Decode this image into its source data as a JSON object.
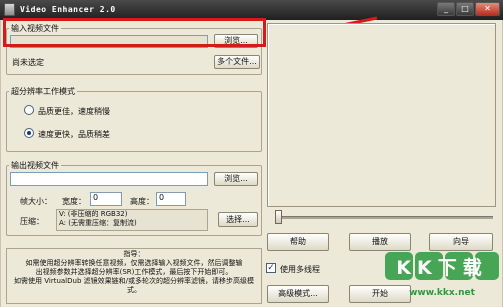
{
  "window": {
    "title": "Video Enhancer 2.0",
    "min": "_",
    "max": "□",
    "close": "✕"
  },
  "input": {
    "legend": "输入视频文件",
    "value": "",
    "browse": "浏览...",
    "status": "尚未选定",
    "multi": "多个文件..."
  },
  "mode": {
    "legend": "超分辨率工作模式",
    "options": [
      {
        "label": "品质更佳，速度稍慢",
        "selected": false
      },
      {
        "label": "速度更快，品质稍差",
        "selected": true
      }
    ]
  },
  "output": {
    "legend": "输出视频文件",
    "value": "",
    "browse": "浏览...",
    "frame_label": "帧大小：",
    "width_label": "宽度：",
    "width_value": "0",
    "height_label": "高度：",
    "height_value": "0",
    "compress_label": "压缩：",
    "compress_v": "V: (非压缩的 RGB32)",
    "compress_a": "A: (无需重压缩：复制流)",
    "choose": "选择..."
  },
  "help": {
    "title": "指导：",
    "lines": [
      "如需使用超分辨率转换任意视频，仅需选择输入视频文件，然后调整输",
      "出视频参数并选择超分辨率(SR)工作模式，最后按下开始即可。",
      "如需使用 VirtualDub 滤镜效果链和/或多轮次的超分辨率滤镜，请移步高级模",
      "式。"
    ]
  },
  "buttons": {
    "help": "帮助",
    "play": "播放",
    "wizard": "向导",
    "advanced": "高级模式...",
    "start": "开始"
  },
  "multithread": {
    "label": "使用多线程",
    "checked": true
  },
  "watermark": {
    "text": "KK下载",
    "url": "www.kkx.net"
  },
  "accent": {
    "highlight": "#d41a1a",
    "watermark": "#2a9a3e"
  }
}
